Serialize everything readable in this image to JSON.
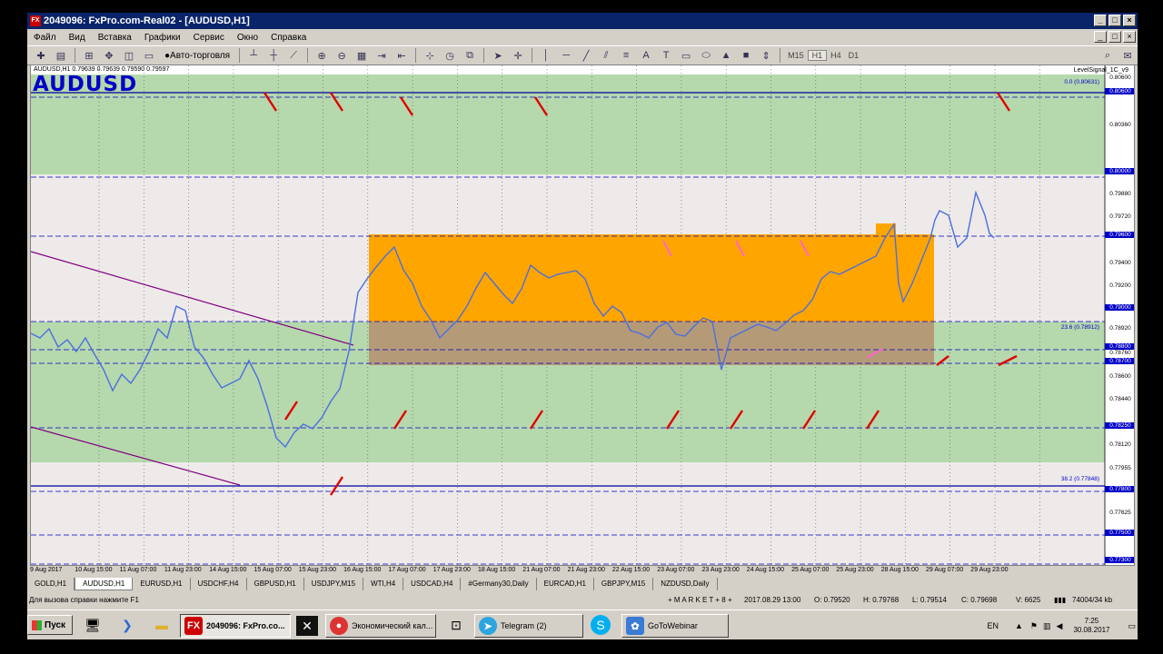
{
  "window": {
    "title": "2049096: FxPro.com-Real02 - [AUDUSD,H1]"
  },
  "menu": [
    "Файл",
    "Вид",
    "Вставка",
    "Графики",
    "Сервис",
    "Окно",
    "Справка"
  ],
  "toolbar": {
    "autotrade_label": "Авто-торговля",
    "timeframes": [
      "M15",
      "H1",
      "H4",
      "D1"
    ]
  },
  "chart": {
    "header": "AUDUSD,H1  0.79639 0.79639 0.79590 0.79597",
    "symbol": "AUDUSD",
    "indicator": "LevelSignal_1C_v9",
    "fib_labels": [
      "0.0 (0.80631)",
      "23.6 (0.78912)",
      "38.2 (0.77848)"
    ],
    "price_labels": [
      "0.80600",
      "0.80600",
      "0.80360",
      "0.80000",
      "0.79880",
      "0.79720",
      "0.79600",
      "0.79400",
      "0.79200",
      "0.79000",
      "0.78920",
      "0.78800",
      "0.78760",
      "0.78700",
      "0.78600",
      "0.78440",
      "0.78250",
      "0.78120",
      "0.77955",
      "0.77800",
      "0.77625",
      "0.77500",
      "0.77300"
    ],
    "highlighted_prices": [
      "0.80600",
      "0.80000",
      "0.79600",
      "0.79000",
      "0.78800",
      "0.78700",
      "0.78250",
      "0.77800",
      "0.77500",
      "0.77300"
    ],
    "time_labels": [
      "9 Aug 2017",
      "10 Aug 15:00",
      "11 Aug 07:00",
      "11 Aug 23:00",
      "14 Aug 15:00",
      "15 Aug 07:00",
      "15 Aug 23:00",
      "16 Aug 15:00",
      "17 Aug 07:00",
      "17 Aug 23:00",
      "18 Aug 15:00",
      "21 Aug 07:00",
      "21 Aug 23:00",
      "22 Aug 15:00",
      "23 Aug 07:00",
      "23 Aug 23:00",
      "24 Aug 15:00",
      "25 Aug 07:00",
      "25 Aug 23:00",
      "28 Aug 15:00",
      "29 Aug 07:00",
      "29 Aug 23:00"
    ]
  },
  "tabs": [
    "GOLD,H1",
    "AUDUSD,H1",
    "EURUSD,H1",
    "USDCHF,H4",
    "GBPUSD,H1",
    "USDJPY,M15",
    "WTI,H4",
    "USDCAD,H4",
    "#Germany30,Daily",
    "EURCAD,H1",
    "GBPJPY,M15",
    "NZDUSD,Daily"
  ],
  "active_tab": "AUDUSD,H1",
  "status": {
    "help": "Для вызова справки нажмите F1",
    "profile": "+ M A R K E T + 8 +",
    "time": "2017.08.29 13:00",
    "open": "O: 0.79520",
    "high": "H: 0.79768",
    "low": "L: 0.79514",
    "close": "C: 0.79698",
    "volume": "V: 6625",
    "traffic": "74004/34 kb"
  },
  "taskbar": {
    "start": "Пуск",
    "buttons": [
      "2049096: FxPro.co...",
      "Экономический кал...",
      "Telegram (2)",
      "GoToWebinar"
    ],
    "lang": "EN",
    "time": "7:25",
    "date": "30.08.2017"
  }
}
